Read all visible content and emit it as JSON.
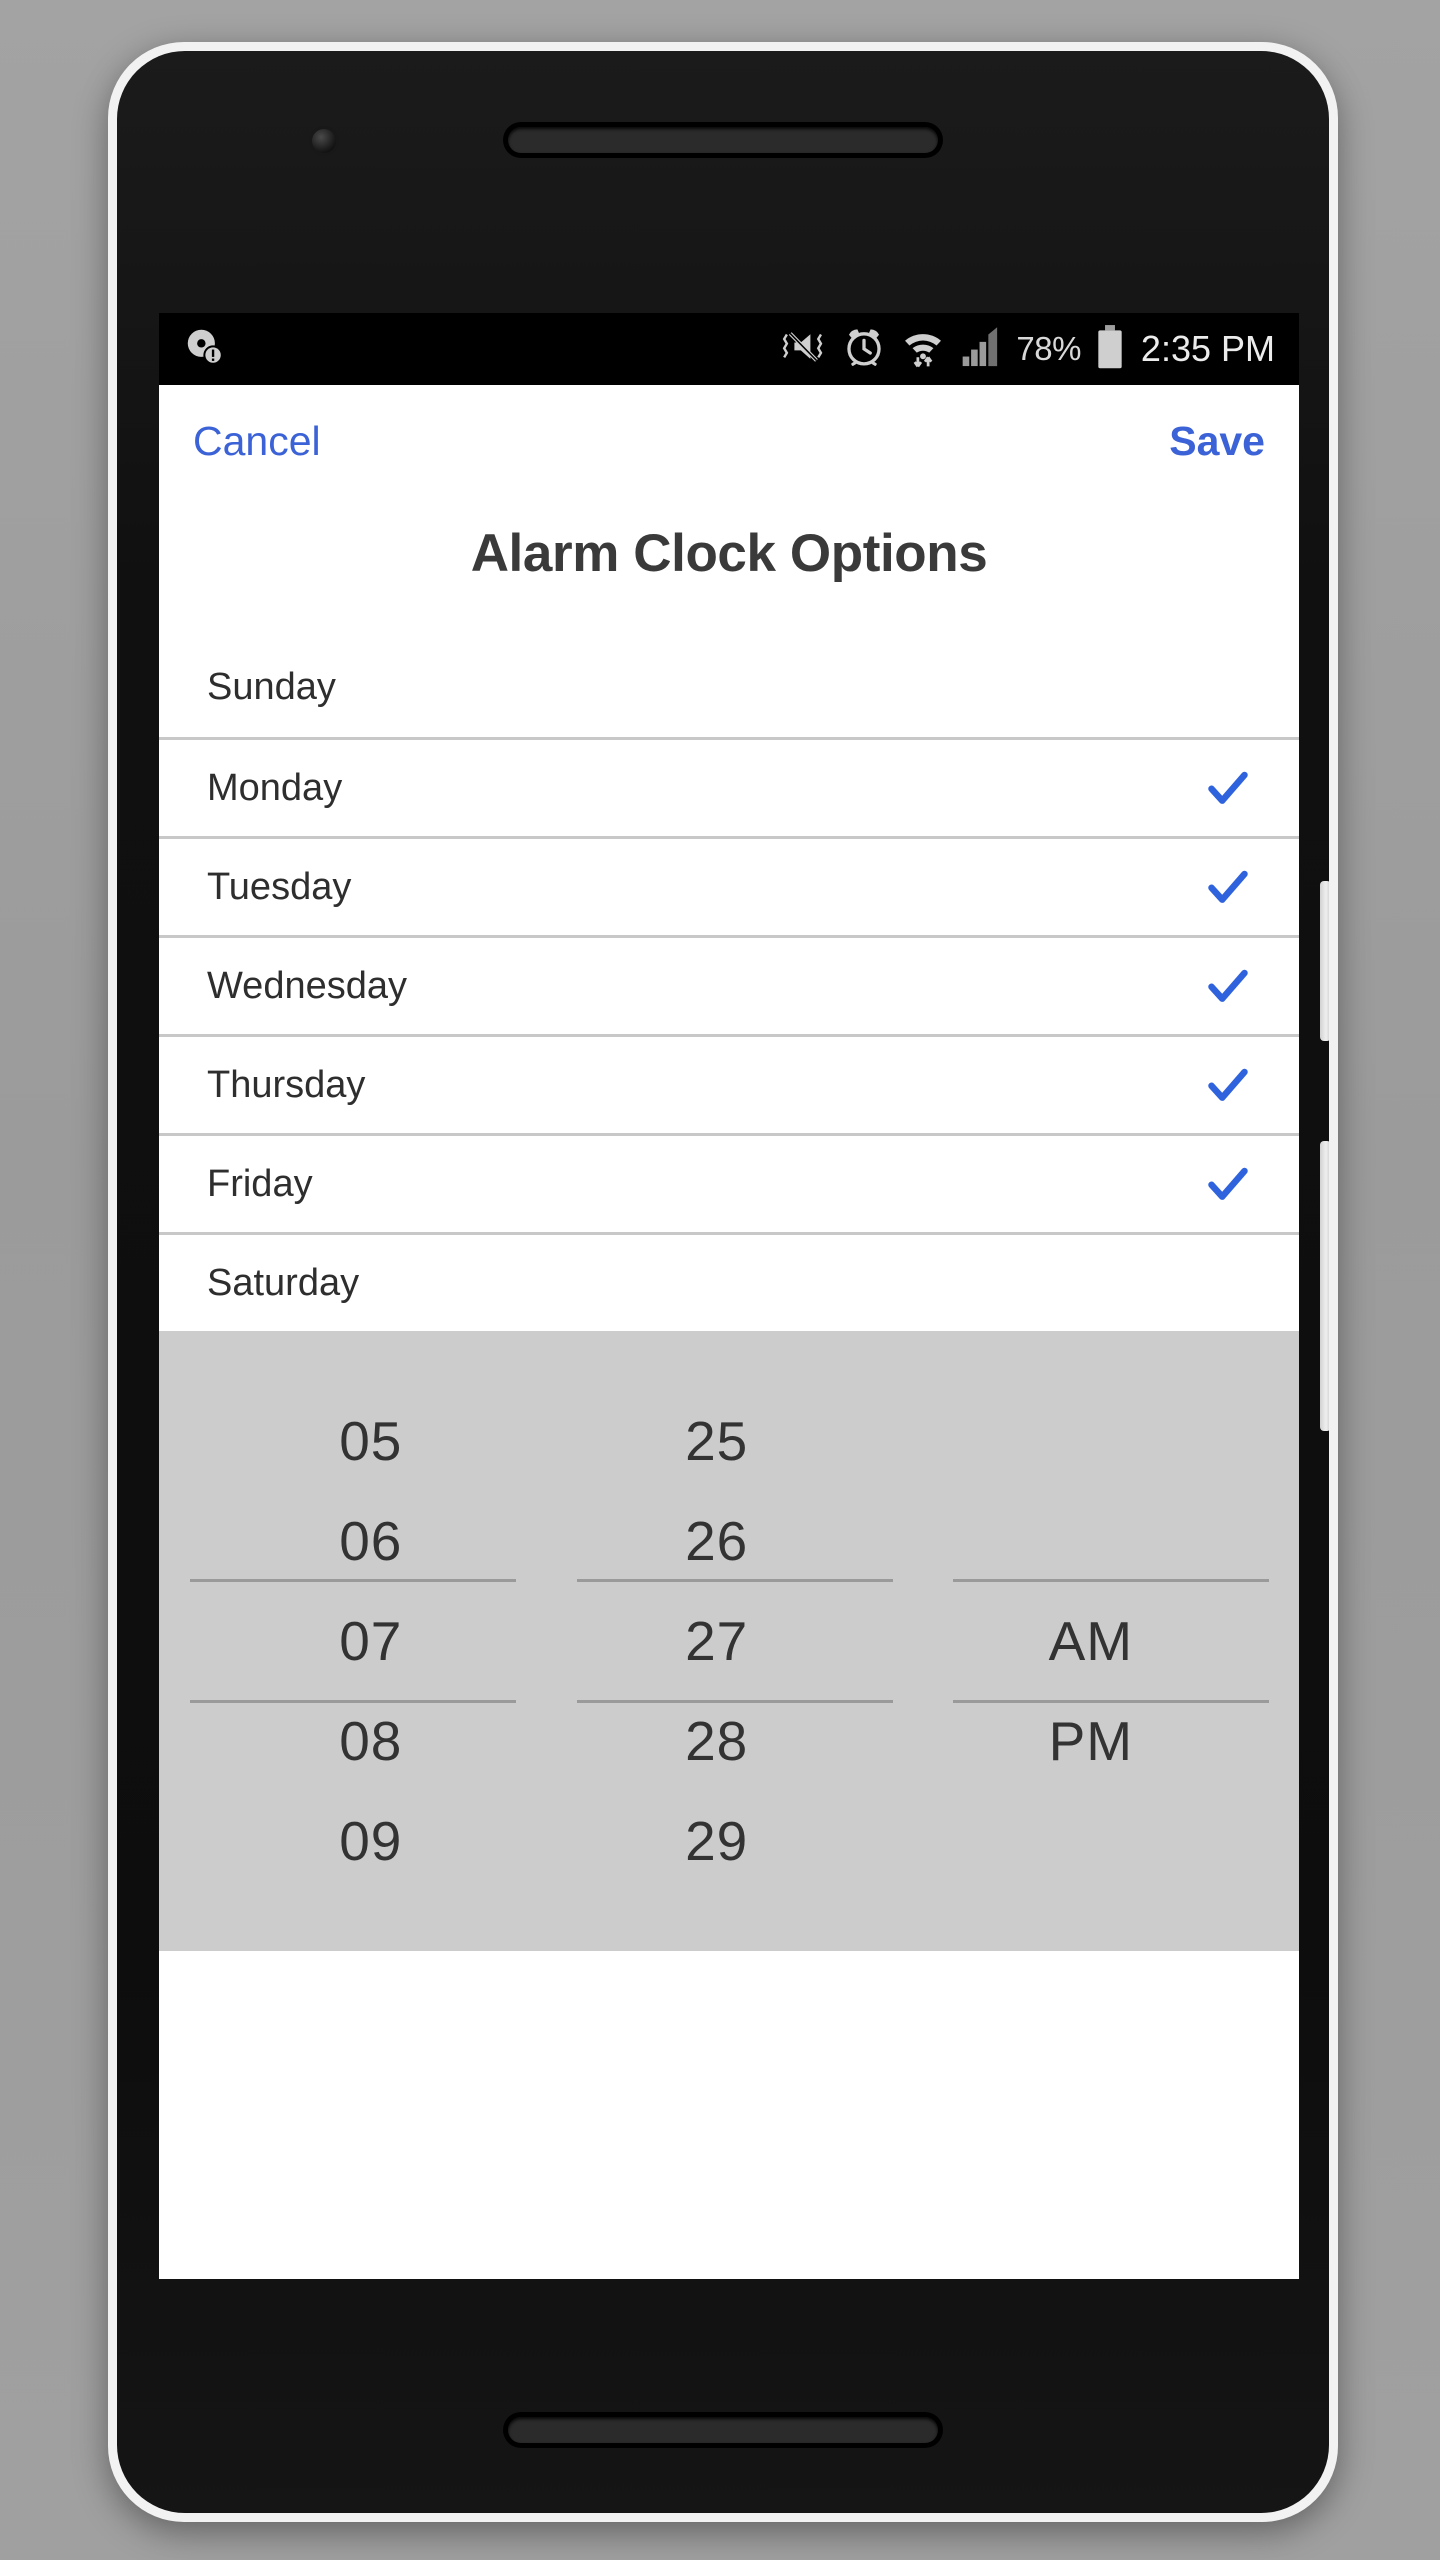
{
  "device": {
    "frame_color": "#f2f2f2",
    "body_color": "#131313"
  },
  "status_bar": {
    "background": "#000000",
    "left_icons": [
      {
        "name": "disc-warning-icon",
        "glyph": "disc-alert"
      }
    ],
    "right_icons": [
      {
        "name": "vibrate-mute-icon",
        "glyph": "volume-off-vibrate"
      },
      {
        "name": "alarm-icon",
        "glyph": "alarm-clock"
      },
      {
        "name": "wifi-icon",
        "glyph": "wifi-transfer"
      },
      {
        "name": "cellular-signal-icon",
        "glyph": "signal-bars"
      }
    ],
    "battery_percent": "78%",
    "battery_icon": "battery-full-icon",
    "clock": "2:35 PM"
  },
  "header": {
    "cancel_label": "Cancel",
    "save_label": "Save",
    "accent_color": "#3b62d6"
  },
  "dialog": {
    "title": "Alarm Clock Options"
  },
  "days": [
    {
      "label": "Sunday",
      "checked": false
    },
    {
      "label": "Monday",
      "checked": true
    },
    {
      "label": "Tuesday",
      "checked": true
    },
    {
      "label": "Wednesday",
      "checked": true
    },
    {
      "label": "Thursday",
      "checked": true
    },
    {
      "label": "Friday",
      "checked": true
    },
    {
      "label": "Saturday",
      "checked": false
    }
  ],
  "check_color": "#2f63dd",
  "time_picker": {
    "background": "#cccccc",
    "hours": [
      "05",
      "06",
      "07",
      "08",
      "09"
    ],
    "minutes": [
      "25",
      "26",
      "27",
      "28",
      "29"
    ],
    "meridiem": [
      "",
      "",
      "AM",
      "PM",
      ""
    ],
    "selected": {
      "hour": "07",
      "minute": "27",
      "meridiem": "AM"
    },
    "selected_index": 2
  }
}
